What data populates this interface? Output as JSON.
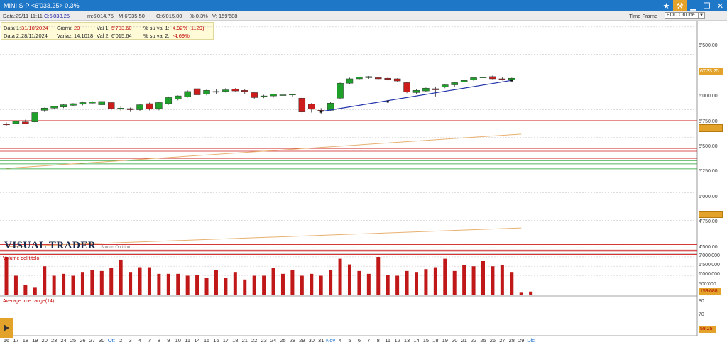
{
  "window": {
    "title": "MINI S-P <6'033.25> 0.3%",
    "controls": [
      "star-icon",
      "tools-icon",
      "minimize-icon",
      "restore-icon",
      "close-icon"
    ]
  },
  "infobar": {
    "date": "Data:29/11 11:11",
    "close": "C:6'033.25",
    "min": "m:6'014.75",
    "max": "M:6'035.50",
    "open": "O:6'015.00",
    "pct": "%:0.3%",
    "volume": "V:",
    "volume_value": "159'688",
    "timeframe_label": "Time Frame",
    "timeframe_value": "EOD OnLine"
  },
  "databox": {
    "data1_label": "Data 1:",
    "data1_value": "31/10/2024",
    "giorni_label": "Giorni:",
    "giorni_value": "20",
    "val1_label": "Val 1:",
    "val1_value": "5'733.60",
    "su_val1_label": "% su val 1:",
    "su_val1_value": "4.92% (1129)",
    "data2_label": "Data 2:",
    "data2_value": "28/11/2024",
    "variaz_label": "Variaz:",
    "variaz_value": "14,1018",
    "val2_label": "Val 2:",
    "val2_value": "6'015.64",
    "su_val2_label": "% su val 2:",
    "su_val2_value": "-4.69%"
  },
  "logo": {
    "main": "VISUAL TRADER",
    "sub": "Storico On Line"
  },
  "price_axis": {
    "ticks": [
      "6'500.00",
      "6'250.00",
      "6'000.00",
      "5'750.00",
      "5'500.00",
      "5'250.00",
      "5'000.00",
      "4'750.00",
      "4'500.00"
    ],
    "badge": "6'033.25"
  },
  "volume_panel": {
    "label": "Volume del titolo",
    "ticks": [
      "2'000'000",
      "1'500'000",
      "1'000'000",
      "500'000"
    ],
    "badge": "159'688"
  },
  "atr_panel": {
    "label": "Average true range(14)",
    "ticks": [
      "80",
      "70"
    ],
    "badge": "58.25"
  },
  "colors": {
    "bull": "#1fa02a",
    "bear": "#cc1c1c",
    "accent": "#e3a32a",
    "titlebar": "#1f77c8",
    "volume": "#c01818"
  },
  "chart_data": {
    "type": "candlestick",
    "x_labels": [
      "16",
      "17",
      "18",
      "19",
      "20",
      "23",
      "24",
      "25",
      "26",
      "27",
      "30",
      "Ott",
      "2",
      "3",
      "4",
      "7",
      "8",
      "9",
      "10",
      "11",
      "14",
      "15",
      "16",
      "17",
      "18",
      "21",
      "22",
      "23",
      "24",
      "25",
      "28",
      "29",
      "30",
      "31",
      "Nov",
      "4",
      "5",
      "6",
      "7",
      "8",
      "11",
      "12",
      "13",
      "14",
      "15",
      "18",
      "19",
      "20",
      "21",
      "22",
      "25",
      "26",
      "27",
      "28",
      "29",
      "Dic"
    ],
    "candles": [
      {
        "o": 5620,
        "h": 5635,
        "l": 5605,
        "c": 5615
      },
      {
        "o": 5625,
        "h": 5655,
        "l": 5615,
        "c": 5645
      },
      {
        "o": 5640,
        "h": 5660,
        "l": 5620,
        "c": 5625
      },
      {
        "o": 5640,
        "h": 5730,
        "l": 5630,
        "c": 5725
      },
      {
        "o": 5745,
        "h": 5770,
        "l": 5730,
        "c": 5765
      },
      {
        "o": 5765,
        "h": 5785,
        "l": 5755,
        "c": 5780
      },
      {
        "o": 5775,
        "h": 5800,
        "l": 5765,
        "c": 5795
      },
      {
        "o": 5790,
        "h": 5810,
        "l": 5780,
        "c": 5805
      },
      {
        "o": 5800,
        "h": 5825,
        "l": 5790,
        "c": 5815
      },
      {
        "o": 5810,
        "h": 5830,
        "l": 5800,
        "c": 5820
      },
      {
        "o": 5795,
        "h": 5825,
        "l": 5790,
        "c": 5825
      },
      {
        "o": 5815,
        "h": 5825,
        "l": 5745,
        "c": 5760
      },
      {
        "o": 5760,
        "h": 5780,
        "l": 5740,
        "c": 5765
      },
      {
        "o": 5760,
        "h": 5770,
        "l": 5730,
        "c": 5750
      },
      {
        "o": 5750,
        "h": 5800,
        "l": 5735,
        "c": 5795
      },
      {
        "o": 5805,
        "h": 5815,
        "l": 5745,
        "c": 5755
      },
      {
        "o": 5760,
        "h": 5820,
        "l": 5745,
        "c": 5815
      },
      {
        "o": 5805,
        "h": 5870,
        "l": 5795,
        "c": 5860
      },
      {
        "o": 5845,
        "h": 5880,
        "l": 5835,
        "c": 5875
      },
      {
        "o": 5865,
        "h": 5925,
        "l": 5860,
        "c": 5915
      },
      {
        "o": 5940,
        "h": 5950,
        "l": 5880,
        "c": 5885
      },
      {
        "o": 5890,
        "h": 5935,
        "l": 5880,
        "c": 5925
      },
      {
        "o": 5910,
        "h": 5935,
        "l": 5895,
        "c": 5915
      },
      {
        "o": 5915,
        "h": 5945,
        "l": 5905,
        "c": 5930
      },
      {
        "o": 5935,
        "h": 5945,
        "l": 5915,
        "c": 5920
      },
      {
        "o": 5925,
        "h": 5935,
        "l": 5895,
        "c": 5915
      },
      {
        "o": 5905,
        "h": 5915,
        "l": 5845,
        "c": 5860
      },
      {
        "o": 5870,
        "h": 5885,
        "l": 5855,
        "c": 5875
      },
      {
        "o": 5875,
        "h": 5895,
        "l": 5860,
        "c": 5890
      },
      {
        "o": 5885,
        "h": 5900,
        "l": 5860,
        "c": 5885
      },
      {
        "o": 5885,
        "h": 5895,
        "l": 5870,
        "c": 5890
      },
      {
        "o": 5855,
        "h": 5865,
        "l": 5715,
        "c": 5730
      },
      {
        "o": 5800,
        "h": 5810,
        "l": 5725,
        "c": 5755
      },
      {
        "o": 5745,
        "h": 5765,
        "l": 5715,
        "c": 5740
      },
      {
        "o": 5745,
        "h": 5820,
        "l": 5735,
        "c": 5810
      },
      {
        "o": 5855,
        "h": 5995,
        "l": 5850,
        "c": 5990
      },
      {
        "o": 5990,
        "h": 6040,
        "l": 5980,
        "c": 6030
      },
      {
        "o": 6030,
        "h": 6050,
        "l": 6020,
        "c": 6045
      },
      {
        "o": 6040,
        "h": 6055,
        "l": 6030,
        "c": 6050
      },
      {
        "o": 6040,
        "h": 6050,
        "l": 6020,
        "c": 6030
      },
      {
        "o": 6035,
        "h": 6045,
        "l": 6015,
        "c": 6025
      },
      {
        "o": 6030,
        "h": 6035,
        "l": 6005,
        "c": 6010
      },
      {
        "o": 5995,
        "h": 6000,
        "l": 5900,
        "c": 5910
      },
      {
        "o": 5905,
        "h": 5935,
        "l": 5890,
        "c": 5925
      },
      {
        "o": 5920,
        "h": 5950,
        "l": 5910,
        "c": 5945
      },
      {
        "o": 5940,
        "h": 5960,
        "l": 5870,
        "c": 5930
      },
      {
        "o": 5955,
        "h": 5985,
        "l": 5945,
        "c": 5975
      },
      {
        "o": 5975,
        "h": 6000,
        "l": 5955,
        "c": 5995
      },
      {
        "o": 6000,
        "h": 6020,
        "l": 5990,
        "c": 6015
      },
      {
        "o": 6020,
        "h": 6045,
        "l": 6010,
        "c": 6040
      },
      {
        "o": 6040,
        "h": 6050,
        "l": 6030,
        "c": 6045
      },
      {
        "o": 6050,
        "h": 6060,
        "l": 6025,
        "c": 6030
      },
      {
        "o": 6030,
        "h": 6045,
        "l": 6015,
        "c": 6025
      },
      {
        "o": 6020,
        "h": 6040,
        "l": 6010,
        "c": 6035
      }
    ],
    "volume": [
      2000000,
      1000000,
      500000,
      400000,
      1500000,
      1000000,
      1100000,
      1000000,
      1200000,
      1300000,
      1250000,
      1400000,
      1850000,
      1200000,
      1450000,
      1450000,
      1100000,
      1100000,
      1100000,
      1000000,
      1050000,
      900000,
      1300000,
      900000,
      1200000,
      800000,
      1000000,
      1000000,
      1400000,
      1100000,
      1300000,
      1000000,
      1100000,
      1000000,
      1300000,
      1900000,
      1600000,
      1250000,
      1100000,
      2000000,
      1050000,
      1000000,
      1250000,
      1200000,
      1350000,
      1450000,
      1900000,
      1250000,
      1550000,
      1500000,
      1800000,
      1500000,
      1550000,
      1200000,
      100000,
      159688
    ],
    "atr_last": 58.25,
    "price_range": [
      4450,
      6550
    ],
    "horizontal_levels": [
      5650,
      5400,
      5375,
      5310,
      5290,
      5260,
      5215,
      4530,
      4480,
      4470,
      4440
    ],
    "level_colors": [
      "#cc1c1c",
      "#cc1c1c",
      "#cc1c1c",
      "#cc1c1c",
      "#1fa02a",
      "#1fa02a",
      "#1fa02a",
      "#cc1c1c",
      "#cc1c1c",
      "#cc1c1c",
      "#cc1c1c"
    ],
    "moving_averages": [
      {
        "from": [
          0,
          5220
        ],
        "to": [
          54,
          5530
        ],
        "color": "#e8b070"
      },
      {
        "from": [
          0,
          4510
        ],
        "to": [
          54,
          4680
        ],
        "color": "#e8b070"
      }
    ],
    "trendline": {
      "from": [
        33,
        5733.6
      ],
      "to": [
        53,
        6015.64
      ],
      "color": "#2233aa"
    }
  }
}
